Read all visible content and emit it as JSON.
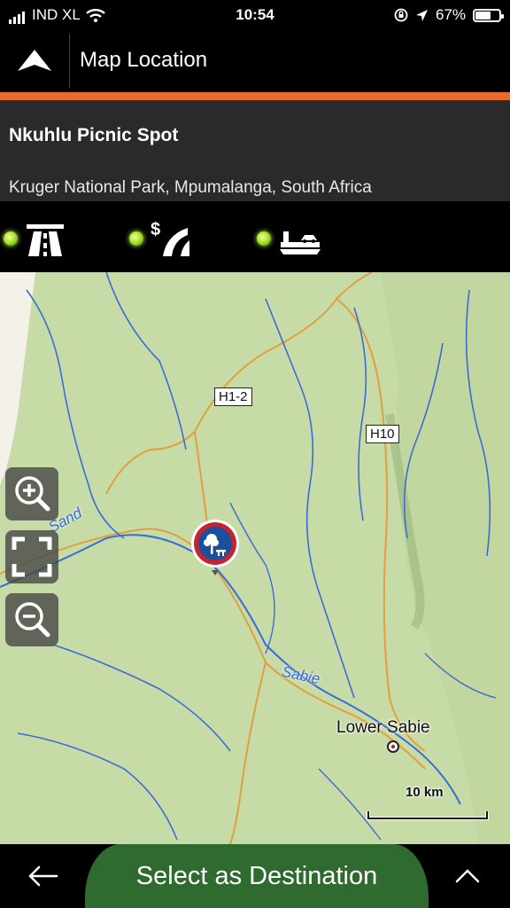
{
  "status_bar": {
    "carrier": "IND XL",
    "time": "10:54",
    "battery_percent": "67%",
    "battery_level": 0.67
  },
  "header": {
    "title": "Map Location",
    "back_icon": "up-arrow-icon"
  },
  "place": {
    "name": "Nkuhlu Picnic Spot",
    "address": "Kruger National Park, Mpumalanga, South Africa"
  },
  "route_options": [
    {
      "icon": "highway-icon",
      "enabled": true
    },
    {
      "icon": "toll-road-icon",
      "enabled": true
    },
    {
      "icon": "ferry-icon",
      "enabled": true
    }
  ],
  "map": {
    "road_labels": [
      "H1-2",
      "H10"
    ],
    "river_labels": [
      "Sand",
      "Sabie"
    ],
    "town": "Lower Sabie",
    "scale": "10 km",
    "marker_icon": "picnic-tree-icon"
  },
  "map_controls": [
    "zoom-in-icon",
    "fit-view-icon",
    "zoom-out-icon"
  ],
  "bottom_bar": {
    "back_icon": "left-arrow-icon",
    "primary_action": "Select as Destination",
    "expand_icon": "chevron-up-icon"
  },
  "colors": {
    "accent": "#e86a2c",
    "button_green": "#2f6a2e",
    "map_land": "#c7dba7",
    "river": "#3b6cd6",
    "road": "#e0a03c"
  }
}
